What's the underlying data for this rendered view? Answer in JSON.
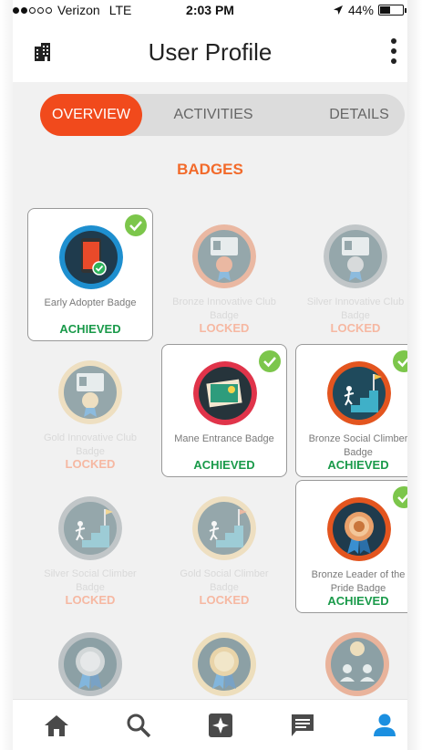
{
  "status_bar": {
    "carrier": "Verizon",
    "network": "LTE",
    "time": "2:03 PM",
    "battery": "44%",
    "battery_level": 0.44
  },
  "nav": {
    "title": "User Profile",
    "left_icon": "building-icon",
    "right_icon": "more-vertical-icon"
  },
  "tabs": [
    {
      "label": "OVERVIEW",
      "active": true
    },
    {
      "label": "ACTIVITIES",
      "active": false
    },
    {
      "label": "DETAILS",
      "active": false
    }
  ],
  "section_title": "BADGES",
  "badges": [
    {
      "name": "Early Adopter Badge",
      "status": "ACHIEVED",
      "icon": "phone-icon"
    },
    {
      "name": "Bronze Innovative Club Badge",
      "status": "LOCKED",
      "icon": "id-card-50-icon"
    },
    {
      "name": "Silver Innovative Club Badge",
      "status": "LOCKED",
      "icon": "id-card-75-icon"
    },
    {
      "name": "Gold Innovative Club Badge",
      "status": "LOCKED",
      "icon": "id-card-90-icon"
    },
    {
      "name": "Mane Entrance Badge",
      "status": "ACHIEVED",
      "icon": "photo-icon"
    },
    {
      "name": "Bronze Social Climber Badge",
      "status": "ACHIEVED",
      "icon": "stairs-10-icon"
    },
    {
      "name": "Silver Social Climber Badge",
      "status": "LOCKED",
      "icon": "stairs-100-icon"
    },
    {
      "name": "Gold Social Climber Badge",
      "status": "LOCKED",
      "icon": "stairs-1000-icon"
    },
    {
      "name": "Bronze Leader of the Pride Badge",
      "status": "ACHIEVED",
      "icon": "lion-medal-icon"
    }
  ],
  "partial_badges": [
    "lion-medal-icon",
    "lion-medal-icon",
    "people-5-icon"
  ],
  "tab_bar": [
    "home-icon",
    "search-icon",
    "star-card-icon",
    "chat-icon",
    "profile-icon"
  ],
  "colors": {
    "accent": "#f14a1c",
    "achieved": "#1a9a4a",
    "section": "#f26a2a",
    "check": "#7cc64b",
    "active_tab_icon": "#1b8fe0"
  }
}
